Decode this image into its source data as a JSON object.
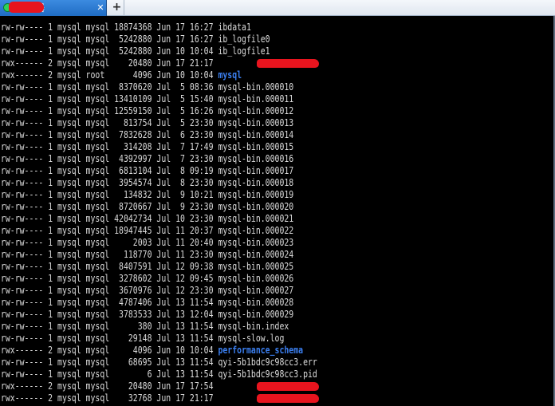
{
  "tab": {
    "title": "服务器",
    "close_glyph": "✕",
    "add_glyph": "+",
    "status_color": "#2fd35a"
  },
  "colors": {
    "background": "#000000",
    "text": "#dcdcdc",
    "directory": "#3b7ff0",
    "redaction": "#e8141e",
    "tab_active": "#2a7ad6"
  },
  "listing": [
    {
      "perms": "-rw-rw----",
      "links": "1",
      "owner": "mysql",
      "group": "mysql",
      "size": "18874368",
      "month": "Jun",
      "day": "17",
      "time": "16:27",
      "name": "ibdata1",
      "is_dir": false
    },
    {
      "perms": "-rw-rw----",
      "links": "1",
      "owner": "mysql",
      "group": "mysql",
      "size": "5242880",
      "month": "Jun",
      "day": "17",
      "time": "16:27",
      "name": "ib_logfile0",
      "is_dir": false
    },
    {
      "perms": "-rw-rw----",
      "links": "1",
      "owner": "mysql",
      "group": "mysql",
      "size": "5242880",
      "month": "Jun",
      "day": "10",
      "time": "10:04",
      "name": "ib_logfile1",
      "is_dir": false
    },
    {
      "perms": "drwx------",
      "links": "2",
      "owner": "mysql",
      "group": "mysql",
      "size": "20480",
      "month": "Jun",
      "day": "17",
      "time": "21:17",
      "name": "",
      "is_dir": true,
      "redacted": true
    },
    {
      "perms": "drwx------",
      "links": "2",
      "owner": "mysql",
      "group": "root",
      "size": "4096",
      "month": "Jun",
      "day": "10",
      "time": "10:04",
      "name": "mysql",
      "is_dir": true
    },
    {
      "perms": "-rw-rw----",
      "links": "1",
      "owner": "mysql",
      "group": "mysql",
      "size": "8370620",
      "month": "Jul",
      "day": "5",
      "time": "08:36",
      "name": "mysql-bin.000010",
      "is_dir": false
    },
    {
      "perms": "-rw-rw----",
      "links": "1",
      "owner": "mysql",
      "group": "mysql",
      "size": "13410109",
      "month": "Jul",
      "day": "5",
      "time": "15:40",
      "name": "mysql-bin.000011",
      "is_dir": false
    },
    {
      "perms": "-rw-rw----",
      "links": "1",
      "owner": "mysql",
      "group": "mysql",
      "size": "12559150",
      "month": "Jul",
      "day": "5",
      "time": "16:26",
      "name": "mysql-bin.000012",
      "is_dir": false
    },
    {
      "perms": "-rw-rw----",
      "links": "1",
      "owner": "mysql",
      "group": "mysql",
      "size": "813754",
      "month": "Jul",
      "day": "5",
      "time": "23:30",
      "name": "mysql-bin.000013",
      "is_dir": false
    },
    {
      "perms": "-rw-rw----",
      "links": "1",
      "owner": "mysql",
      "group": "mysql",
      "size": "7832628",
      "month": "Jul",
      "day": "6",
      "time": "23:30",
      "name": "mysql-bin.000014",
      "is_dir": false
    },
    {
      "perms": "-rw-rw----",
      "links": "1",
      "owner": "mysql",
      "group": "mysql",
      "size": "314208",
      "month": "Jul",
      "day": "7",
      "time": "17:49",
      "name": "mysql-bin.000015",
      "is_dir": false
    },
    {
      "perms": "-rw-rw----",
      "links": "1",
      "owner": "mysql",
      "group": "mysql",
      "size": "4392997",
      "month": "Jul",
      "day": "7",
      "time": "23:30",
      "name": "mysql-bin.000016",
      "is_dir": false
    },
    {
      "perms": "-rw-rw----",
      "links": "1",
      "owner": "mysql",
      "group": "mysql",
      "size": "6813104",
      "month": "Jul",
      "day": "8",
      "time": "09:19",
      "name": "mysql-bin.000017",
      "is_dir": false
    },
    {
      "perms": "-rw-rw----",
      "links": "1",
      "owner": "mysql",
      "group": "mysql",
      "size": "3954574",
      "month": "Jul",
      "day": "8",
      "time": "23:30",
      "name": "mysql-bin.000018",
      "is_dir": false
    },
    {
      "perms": "-rw-rw----",
      "links": "1",
      "owner": "mysql",
      "group": "mysql",
      "size": "134832",
      "month": "Jul",
      "day": "9",
      "time": "10:21",
      "name": "mysql-bin.000019",
      "is_dir": false
    },
    {
      "perms": "-rw-rw----",
      "links": "1",
      "owner": "mysql",
      "group": "mysql",
      "size": "8720667",
      "month": "Jul",
      "day": "9",
      "time": "23:30",
      "name": "mysql-bin.000020",
      "is_dir": false
    },
    {
      "perms": "-rw-rw----",
      "links": "1",
      "owner": "mysql",
      "group": "mysql",
      "size": "42042734",
      "month": "Jul",
      "day": "10",
      "time": "23:30",
      "name": "mysql-bin.000021",
      "is_dir": false
    },
    {
      "perms": "-rw-rw----",
      "links": "1",
      "owner": "mysql",
      "group": "mysql",
      "size": "18947445",
      "month": "Jul",
      "day": "11",
      "time": "20:37",
      "name": "mysql-bin.000022",
      "is_dir": false
    },
    {
      "perms": "-rw-rw----",
      "links": "1",
      "owner": "mysql",
      "group": "mysql",
      "size": "2003",
      "month": "Jul",
      "day": "11",
      "time": "20:40",
      "name": "mysql-bin.000023",
      "is_dir": false
    },
    {
      "perms": "-rw-rw----",
      "links": "1",
      "owner": "mysql",
      "group": "mysql",
      "size": "118770",
      "month": "Jul",
      "day": "11",
      "time": "23:30",
      "name": "mysql-bin.000024",
      "is_dir": false
    },
    {
      "perms": "-rw-rw----",
      "links": "1",
      "owner": "mysql",
      "group": "mysql",
      "size": "8407591",
      "month": "Jul",
      "day": "12",
      "time": "09:38",
      "name": "mysql-bin.000025",
      "is_dir": false
    },
    {
      "perms": "-rw-rw----",
      "links": "1",
      "owner": "mysql",
      "group": "mysql",
      "size": "3278602",
      "month": "Jul",
      "day": "12",
      "time": "09:45",
      "name": "mysql-bin.000026",
      "is_dir": false
    },
    {
      "perms": "-rw-rw----",
      "links": "1",
      "owner": "mysql",
      "group": "mysql",
      "size": "3670976",
      "month": "Jul",
      "day": "12",
      "time": "23:30",
      "name": "mysql-bin.000027",
      "is_dir": false
    },
    {
      "perms": "-rw-rw----",
      "links": "1",
      "owner": "mysql",
      "group": "mysql",
      "size": "4787406",
      "month": "Jul",
      "day": "13",
      "time": "11:54",
      "name": "mysql-bin.000028",
      "is_dir": false
    },
    {
      "perms": "-rw-rw----",
      "links": "1",
      "owner": "mysql",
      "group": "mysql",
      "size": "3783533",
      "month": "Jul",
      "day": "13",
      "time": "12:04",
      "name": "mysql-bin.000029",
      "is_dir": false
    },
    {
      "perms": "-rw-rw----",
      "links": "1",
      "owner": "mysql",
      "group": "mysql",
      "size": "380",
      "month": "Jul",
      "day": "13",
      "time": "11:54",
      "name": "mysql-bin.index",
      "is_dir": false
    },
    {
      "perms": "-rw-rw----",
      "links": "1",
      "owner": "mysql",
      "group": "mysql",
      "size": "29148",
      "month": "Jul",
      "day": "13",
      "time": "11:54",
      "name": "mysql-slow.log",
      "is_dir": false
    },
    {
      "perms": "drwx------",
      "links": "2",
      "owner": "mysql",
      "group": "mysql",
      "size": "4096",
      "month": "Jun",
      "day": "10",
      "time": "10:04",
      "name": "performance_schema",
      "is_dir": true
    },
    {
      "perms": "-rw-rw----",
      "links": "1",
      "owner": "mysql",
      "group": "mysql",
      "size": "68695",
      "month": "Jul",
      "day": "13",
      "time": "11:54",
      "name": "qyi-5b1bdc9c98cc3.err",
      "is_dir": false
    },
    {
      "perms": "-rw-rw----",
      "links": "1",
      "owner": "mysql",
      "group": "mysql",
      "size": "6",
      "month": "Jul",
      "day": "13",
      "time": "11:54",
      "name": "qyi-5b1bdc9c98cc3.pid",
      "is_dir": false
    },
    {
      "perms": "drwx------",
      "links": "2",
      "owner": "mysql",
      "group": "mysql",
      "size": "20480",
      "month": "Jun",
      "day": "17",
      "time": "17:54",
      "name": "",
      "is_dir": true,
      "redacted": true
    },
    {
      "perms": "drwx------",
      "links": "2",
      "owner": "mysql",
      "group": "mysql",
      "size": "32768",
      "month": "Jun",
      "day": "17",
      "time": "21:17",
      "name": "",
      "is_dir": true,
      "redacted": true
    }
  ]
}
